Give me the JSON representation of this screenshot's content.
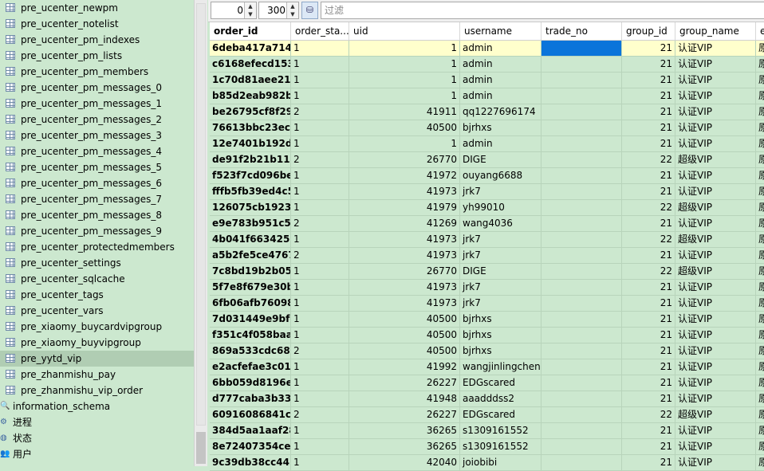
{
  "sidebar": {
    "tables": [
      "pre_ucenter_newpm",
      "pre_ucenter_notelist",
      "pre_ucenter_pm_indexes",
      "pre_ucenter_pm_lists",
      "pre_ucenter_pm_members",
      "pre_ucenter_pm_messages_0",
      "pre_ucenter_pm_messages_1",
      "pre_ucenter_pm_messages_2",
      "pre_ucenter_pm_messages_3",
      "pre_ucenter_pm_messages_4",
      "pre_ucenter_pm_messages_5",
      "pre_ucenter_pm_messages_6",
      "pre_ucenter_pm_messages_7",
      "pre_ucenter_pm_messages_8",
      "pre_ucenter_pm_messages_9",
      "pre_ucenter_protectedmembers",
      "pre_ucenter_settings",
      "pre_ucenter_sqlcache",
      "pre_ucenter_tags",
      "pre_ucenter_vars",
      "pre_xiaomy_buycardvipgroup",
      "pre_xiaomy_buyvipgroup",
      "pre_yytd_vip",
      "pre_zhanmishu_pay",
      "pre_zhanmishu_vip_order"
    ],
    "selected": "pre_yytd_vip",
    "schemas": [
      {
        "label": "information_schema",
        "icon": "database-search-icon"
      },
      {
        "label": "进程",
        "icon": "process-icon"
      },
      {
        "label": "状态",
        "icon": "globe-icon"
      },
      {
        "label": "用户",
        "icon": "users-icon"
      }
    ]
  },
  "toolbar": {
    "offset": "0",
    "limit": "300",
    "filter_placeholder": "过滤",
    "filter_icon": "filter-icon"
  },
  "grid": {
    "columns": [
      "order_id",
      "order_sta...",
      "uid",
      "username",
      "trade_no",
      "group_id",
      "group_name",
      "e"
    ],
    "rows": [
      [
        "6deba417a714",
        "1",
        "1",
        "admin",
        "",
        "21",
        "认证VIP",
        "原"
      ],
      [
        "c6168efecd153",
        "1",
        "1",
        "admin",
        "",
        "21",
        "认证VIP",
        "原"
      ],
      [
        "1c70d81aee21",
        "1",
        "1",
        "admin",
        "",
        "21",
        "认证VIP",
        "原"
      ],
      [
        "b85d2eab982b",
        "1",
        "1",
        "admin",
        "",
        "21",
        "认证VIP",
        "原"
      ],
      [
        "be26795cf8f29",
        "2",
        "41911",
        "qq1227696174",
        "",
        "21",
        "认证VIP",
        "原"
      ],
      [
        "76613bbc23ec",
        "1",
        "40500",
        "bjrhxs",
        "",
        "21",
        "认证VIP",
        "原"
      ],
      [
        "12e7401b192d",
        "1",
        "1",
        "admin",
        "",
        "21",
        "认证VIP",
        "原"
      ],
      [
        "de91f2b21b119",
        "2",
        "26770",
        "DIGE",
        "",
        "22",
        "超级VIP",
        "原"
      ],
      [
        "f523f7cd096be",
        "1",
        "41972",
        "ouyang6688",
        "",
        "21",
        "认证VIP",
        "原"
      ],
      [
        "fffb5fb39ed4c5",
        "1",
        "41973",
        "jrk7",
        "",
        "21",
        "认证VIP",
        "原"
      ],
      [
        "126075cb1923",
        "1",
        "41979",
        "yh99010",
        "",
        "22",
        "超级VIP",
        "原"
      ],
      [
        "e9e783b951c5",
        "2",
        "41269",
        "wang4036",
        "",
        "21",
        "认证VIP",
        "原"
      ],
      [
        "4b041f663425b",
        "1",
        "41973",
        "jrk7",
        "",
        "22",
        "超级VIP",
        "原"
      ],
      [
        "a5b2fe5ce4767",
        "2",
        "41973",
        "jrk7",
        "",
        "21",
        "认证VIP",
        "原"
      ],
      [
        "7c8bd19b2b05",
        "1",
        "26770",
        "DIGE",
        "",
        "22",
        "超级VIP",
        "原"
      ],
      [
        "5f7e8f679e30b",
        "1",
        "41973",
        "jrk7",
        "",
        "21",
        "认证VIP",
        "原"
      ],
      [
        "6fb06afb76098",
        "1",
        "41973",
        "jrk7",
        "",
        "21",
        "认证VIP",
        "原"
      ],
      [
        "7d031449e9bfc",
        "1",
        "40500",
        "bjrhxs",
        "",
        "21",
        "认证VIP",
        "原"
      ],
      [
        "f351c4f058baa",
        "1",
        "40500",
        "bjrhxs",
        "",
        "21",
        "认证VIP",
        "原"
      ],
      [
        "869a533cdc68(",
        "2",
        "40500",
        "bjrhxs",
        "",
        "21",
        "认证VIP",
        "原"
      ],
      [
        "e2acfefae3c01",
        "1",
        "41992",
        "wangjinlingchen",
        "",
        "21",
        "认证VIP",
        "原"
      ],
      [
        "6bb059d8196e",
        "1",
        "26227",
        "EDGscared",
        "",
        "21",
        "认证VIP",
        "原"
      ],
      [
        "d777caba3b33",
        "1",
        "41948",
        "aaadddss2",
        "",
        "21",
        "认证VIP",
        "原"
      ],
      [
        "60916086841c",
        "2",
        "26227",
        "EDGscared",
        "",
        "22",
        "超级VIP",
        "原"
      ],
      [
        "384d5aa1aaf28",
        "1",
        "36265",
        "s1309161552",
        "",
        "21",
        "认证VIP",
        "原"
      ],
      [
        "8e72407354ce",
        "1",
        "36265",
        "s1309161552",
        "",
        "21",
        "认证VIP",
        "原"
      ],
      [
        "9c39db38cc44(",
        "1",
        "42040",
        "joiobibi",
        "",
        "21",
        "认证VIP",
        "原"
      ]
    ]
  },
  "colors": {
    "bg": "#cce8cf",
    "selected_cell": "#0a74da",
    "active_row": "#ffffcc"
  }
}
